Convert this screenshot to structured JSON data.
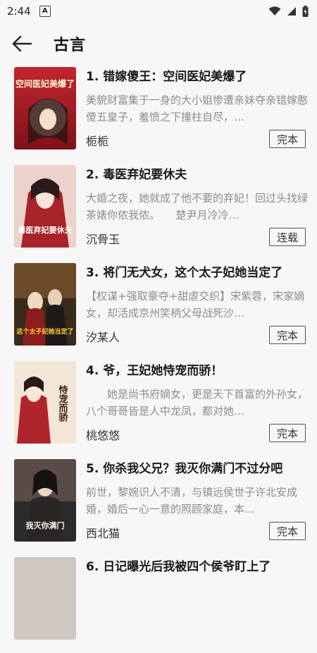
{
  "status_bar": {
    "time": "2:44",
    "badge": "A",
    "icons": [
      "wifi-icon",
      "signal-icon",
      "battery-icon"
    ]
  },
  "app_bar": {
    "back_icon": "arrow-left-icon",
    "title": "古言"
  },
  "books": [
    {
      "title": "1. 错嫁傻王：空间医妃美爆了",
      "desc": "美貌财富集于一身的大小姐惨遭亲妹夺亲错嫁憨傻五皇子，羞愤之下撞柱自尽，…",
      "author": "栀栀",
      "status": "完本",
      "cover_text": "空间医妃美爆了",
      "cover_colors": [
        "#b8222a",
        "#f3d7c2"
      ]
    },
    {
      "title": "2. 毒医弃妃要休夫",
      "desc": "大婚之夜，她就成了他不要的弃妃！回过头找绿茶婊你侬我侬。　　楚尹月冷冷…",
      "author": "沉骨玉",
      "status": "连载",
      "cover_text": "毒医弃妃要休夫",
      "cover_colors": [
        "#e9c9c4",
        "#9b1c20"
      ]
    },
    {
      "title": "3. 将门无犬女，这个太子妃她当定了",
      "desc": "【权谋+强取豪夺+甜虐交织】宋紫蓉，宋家嫡女，却活成京州笑柄父母战死沙…",
      "author": "汐某人",
      "status": "完本",
      "cover_text": "这个太子妃她当定了",
      "cover_colors": [
        "#3a2a1c",
        "#d5322a"
      ]
    },
    {
      "title": "4. 爷，王妃她恃宠而骄！",
      "desc": "　　她是尚书府嫡女，更是天下首富的外孙女，八个哥哥皆是人中龙凤，都对她…",
      "author": "桃悠悠",
      "status": "完本",
      "cover_text": "恃宠而骄",
      "cover_colors": [
        "#f4e6d6",
        "#b0252b"
      ]
    },
    {
      "title": "5. 你杀我父兄？我灭你满门不过分吧",
      "desc": "前世，黎婉识人不清，与镇远侯世子许北安成婚，婚后一心一意的照顾家庭，本…",
      "author": "西北猫",
      "status": "完本",
      "cover_text": "我灭你满门",
      "cover_colors": [
        "#2d2a2c",
        "#c73a2a"
      ]
    }
  ],
  "partial_item": {
    "title": "6. 日记曝光后我被四个侯爷盯上了"
  }
}
